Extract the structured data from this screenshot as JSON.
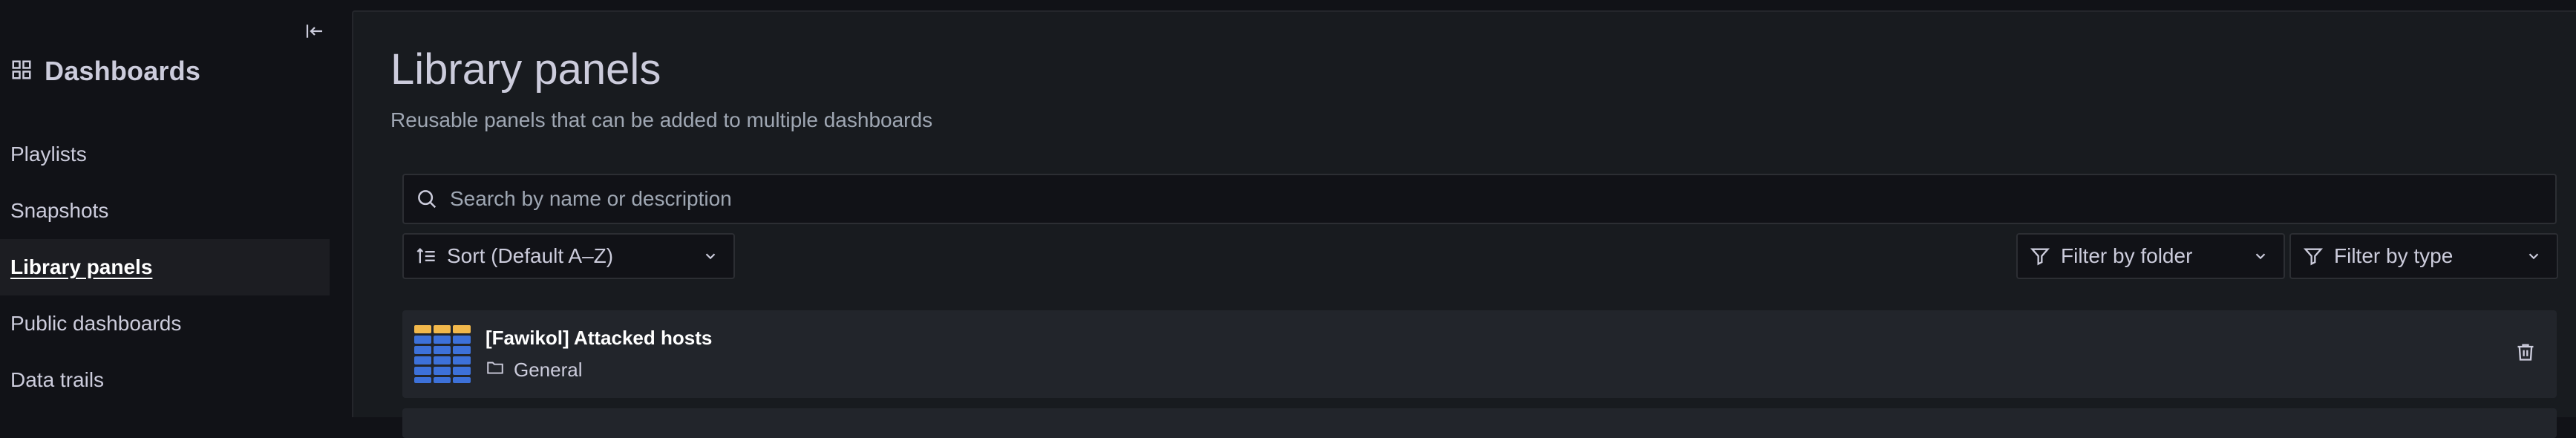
{
  "sidebar": {
    "title": "Dashboards",
    "items": [
      {
        "label": "Playlists"
      },
      {
        "label": "Snapshots"
      },
      {
        "label": "Library panels",
        "active": true
      },
      {
        "label": "Public dashboards"
      },
      {
        "label": "Data trails"
      }
    ]
  },
  "main": {
    "title": "Library panels",
    "subtitle": "Reusable panels that can be added to multiple dashboards",
    "search": {
      "placeholder": "Search by name or description",
      "icon": "search-icon"
    },
    "sort": {
      "label": "Sort (Default A–Z)",
      "icon": "sort-icon"
    },
    "filter_folder": {
      "label": "Filter by folder",
      "icon": "filter-icon"
    },
    "filter_type": {
      "label": "Filter by type",
      "icon": "filter-icon"
    },
    "panels": [
      {
        "title": "[Fawikol] Attacked hosts",
        "folder": "General",
        "thumb_icon": "table-panel-icon"
      }
    ]
  },
  "colors": {
    "background": "#111217",
    "panel": "#181b1f",
    "card": "#22252b",
    "text": "#ccccdc",
    "thumb_header": "#f2b84b",
    "thumb_cells": "#3d71d9"
  }
}
